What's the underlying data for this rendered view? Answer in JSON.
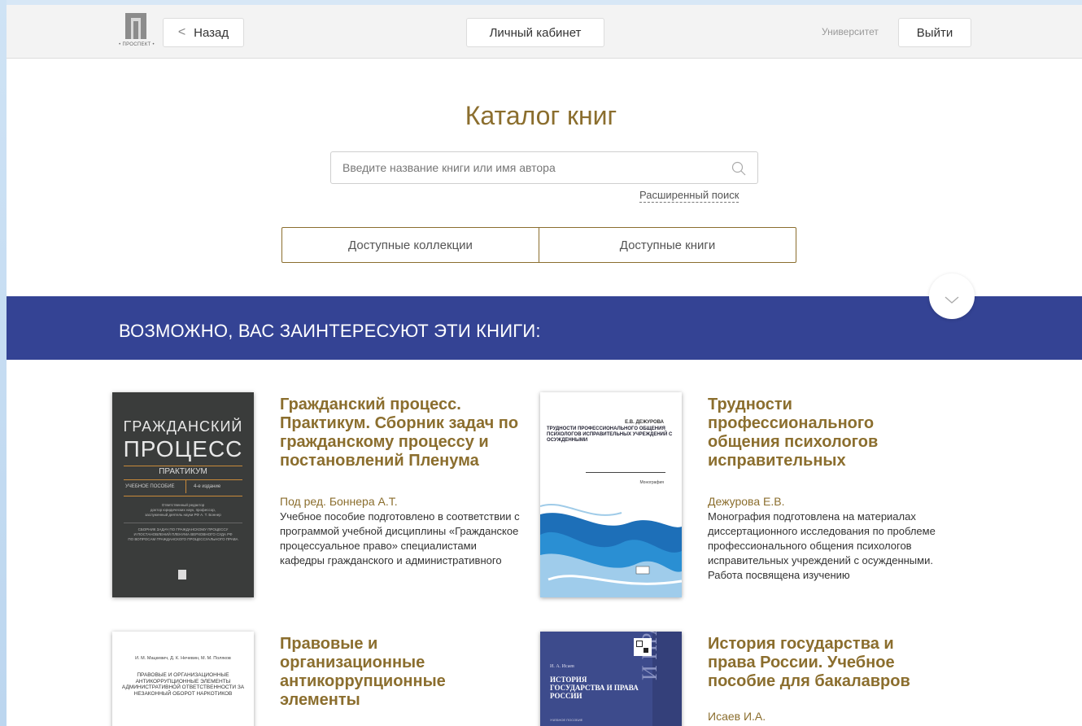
{
  "header": {
    "logo_text": "• ПРОСПЕКТ •",
    "back_label": "Назад",
    "cabinet_label": "Личный кабинет",
    "university_label": "Университет",
    "exit_label": "Выйти"
  },
  "catalog": {
    "title": "Каталог книг",
    "search_placeholder": "Введите название книги или имя автора",
    "advanced_search": "Расширенный поиск",
    "tabs": [
      "Доступные коллекции",
      "Доступные книги"
    ]
  },
  "banner": {
    "title": "ВОЗМОЖНО, ВАС ЗАИНТЕРЕСУЮТ ЭТИ КНИГИ:"
  },
  "books": [
    {
      "title": "Гражданский процесс. Практикум. Сборник задач по гражданскому процессу и постановлений Пленума",
      "author": "Под ред. Боннера А.Т.",
      "description": "Учебное пособие подготовлено в соответствии с программой учебной дисциплины «Гражданское процессуальное право» специалистами кафедры гражданского и административного",
      "cover": {
        "line1": "ГРАЖДАНСКИЙ",
        "line2": "ПРОЦЕСС",
        "line3": "ПРАКТИКУМ",
        "type": "УЧЕБНОЕ ПОСОБИЕ",
        "edition": "4-е издание",
        "editor_1": "Ответственный редактор",
        "editor_2": "доктор юридических наук, профессор,",
        "editor_3": "заслуженный деятель науки РФ А. Т. Боннер",
        "subtitle_1": "СБОРНИК ЗАДАЧ ПО ГРАЖДАНСКОМУ ПРОЦЕССУ",
        "subtitle_2": "И ПОСТАНОВЛЕНИЙ ПЛЕНУМА ВЕРХОВНОГО СУДА РФ",
        "subtitle_3": "ПО ВОПРОСАМ ГРАЖДАНСКОГО ПРОЦЕССУАЛЬНОГО ПРАВА"
      }
    },
    {
      "title": "Трудности профессионального общения психологов исправительных",
      "author": "Дежурова Е.В.",
      "description": "Монография подготовлена на материалах диссертационного исследования по проблеме профессионального общения психологов исправительных учреждений с осужденными. Работа посвящена изучению",
      "cover": {
        "author": "Е.В. ДЕЖУРОВА",
        "title": "ТРУДНОСТИ ПРОФЕССИОНАЛЬНОГО ОБЩЕНИЯ ПСИХОЛОГОВ ИСПРАВИТЕЛЬНЫХ УЧРЕЖДЕНИЙ С ОСУЖДЕННЫМИ",
        "type": "Монография"
      }
    },
    {
      "title": "Правовые и организационные антикоррупционные элементы",
      "cover": {
        "authors": "И. М. Мацкевич, Д. К. Нечевин, М. М. Поляков",
        "title": "ПРАВОВЫЕ И ОРГАНИЗАЦИОННЫЕ АНТИКОРРУПЦИОННЫЕ ЭЛЕМЕНТЫ АДМИНИСТРАТИВНОЙ ОТВЕТСТВЕННОСТИ ЗА НЕЗАКОННЫЙ ОБОРОТ НАРКОТИКОВ"
      }
    },
    {
      "title": "История государства и права России. Учебное пособие для бакалавров",
      "author": "Исаев И.А.",
      "cover": {
        "author": "И. А. Исаев",
        "title": "ИСТОРИЯ ГОСУДАРСТВА И ПРАВА РОССИИ",
        "type": "УЧЕБНОЕ ПОСОБИЕ",
        "spine": "И ПРАВО"
      }
    }
  ],
  "colors": {
    "accent": "#8b6e2e",
    "banner": "#344394",
    "header_bg": "#f3f3f3"
  }
}
